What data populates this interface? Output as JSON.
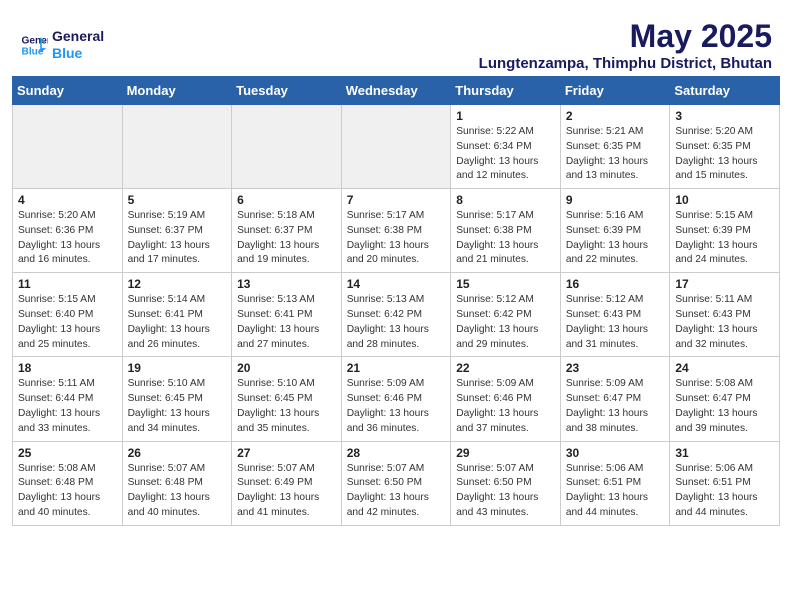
{
  "header": {
    "logo_line1": "General",
    "logo_line2": "Blue",
    "month": "May 2025",
    "location": "Lungtenzampa, Thimphu District, Bhutan"
  },
  "days_of_week": [
    "Sunday",
    "Monday",
    "Tuesday",
    "Wednesday",
    "Thursday",
    "Friday",
    "Saturday"
  ],
  "weeks": [
    [
      {
        "day": "",
        "empty": true
      },
      {
        "day": "",
        "empty": true
      },
      {
        "day": "",
        "empty": true
      },
      {
        "day": "",
        "empty": true
      },
      {
        "day": "1",
        "sunrise": "5:22 AM",
        "sunset": "6:34 PM",
        "daylight": "13 hours and 12 minutes."
      },
      {
        "day": "2",
        "sunrise": "5:21 AM",
        "sunset": "6:35 PM",
        "daylight": "13 hours and 13 minutes."
      },
      {
        "day": "3",
        "sunrise": "5:20 AM",
        "sunset": "6:35 PM",
        "daylight": "13 hours and 15 minutes."
      }
    ],
    [
      {
        "day": "4",
        "sunrise": "5:20 AM",
        "sunset": "6:36 PM",
        "daylight": "13 hours and 16 minutes."
      },
      {
        "day": "5",
        "sunrise": "5:19 AM",
        "sunset": "6:37 PM",
        "daylight": "13 hours and 17 minutes."
      },
      {
        "day": "6",
        "sunrise": "5:18 AM",
        "sunset": "6:37 PM",
        "daylight": "13 hours and 19 minutes."
      },
      {
        "day": "7",
        "sunrise": "5:17 AM",
        "sunset": "6:38 PM",
        "daylight": "13 hours and 20 minutes."
      },
      {
        "day": "8",
        "sunrise": "5:17 AM",
        "sunset": "6:38 PM",
        "daylight": "13 hours and 21 minutes."
      },
      {
        "day": "9",
        "sunrise": "5:16 AM",
        "sunset": "6:39 PM",
        "daylight": "13 hours and 22 minutes."
      },
      {
        "day": "10",
        "sunrise": "5:15 AM",
        "sunset": "6:39 PM",
        "daylight": "13 hours and 24 minutes."
      }
    ],
    [
      {
        "day": "11",
        "sunrise": "5:15 AM",
        "sunset": "6:40 PM",
        "daylight": "13 hours and 25 minutes."
      },
      {
        "day": "12",
        "sunrise": "5:14 AM",
        "sunset": "6:41 PM",
        "daylight": "13 hours and 26 minutes."
      },
      {
        "day": "13",
        "sunrise": "5:13 AM",
        "sunset": "6:41 PM",
        "daylight": "13 hours and 27 minutes."
      },
      {
        "day": "14",
        "sunrise": "5:13 AM",
        "sunset": "6:42 PM",
        "daylight": "13 hours and 28 minutes."
      },
      {
        "day": "15",
        "sunrise": "5:12 AM",
        "sunset": "6:42 PM",
        "daylight": "13 hours and 29 minutes."
      },
      {
        "day": "16",
        "sunrise": "5:12 AM",
        "sunset": "6:43 PM",
        "daylight": "13 hours and 31 minutes."
      },
      {
        "day": "17",
        "sunrise": "5:11 AM",
        "sunset": "6:43 PM",
        "daylight": "13 hours and 32 minutes."
      }
    ],
    [
      {
        "day": "18",
        "sunrise": "5:11 AM",
        "sunset": "6:44 PM",
        "daylight": "13 hours and 33 minutes."
      },
      {
        "day": "19",
        "sunrise": "5:10 AM",
        "sunset": "6:45 PM",
        "daylight": "13 hours and 34 minutes."
      },
      {
        "day": "20",
        "sunrise": "5:10 AM",
        "sunset": "6:45 PM",
        "daylight": "13 hours and 35 minutes."
      },
      {
        "day": "21",
        "sunrise": "5:09 AM",
        "sunset": "6:46 PM",
        "daylight": "13 hours and 36 minutes."
      },
      {
        "day": "22",
        "sunrise": "5:09 AM",
        "sunset": "6:46 PM",
        "daylight": "13 hours and 37 minutes."
      },
      {
        "day": "23",
        "sunrise": "5:09 AM",
        "sunset": "6:47 PM",
        "daylight": "13 hours and 38 minutes."
      },
      {
        "day": "24",
        "sunrise": "5:08 AM",
        "sunset": "6:47 PM",
        "daylight": "13 hours and 39 minutes."
      }
    ],
    [
      {
        "day": "25",
        "sunrise": "5:08 AM",
        "sunset": "6:48 PM",
        "daylight": "13 hours and 40 minutes."
      },
      {
        "day": "26",
        "sunrise": "5:07 AM",
        "sunset": "6:48 PM",
        "daylight": "13 hours and 40 minutes."
      },
      {
        "day": "27",
        "sunrise": "5:07 AM",
        "sunset": "6:49 PM",
        "daylight": "13 hours and 41 minutes."
      },
      {
        "day": "28",
        "sunrise": "5:07 AM",
        "sunset": "6:50 PM",
        "daylight": "13 hours and 42 minutes."
      },
      {
        "day": "29",
        "sunrise": "5:07 AM",
        "sunset": "6:50 PM",
        "daylight": "13 hours and 43 minutes."
      },
      {
        "day": "30",
        "sunrise": "5:06 AM",
        "sunset": "6:51 PM",
        "daylight": "13 hours and 44 minutes."
      },
      {
        "day": "31",
        "sunrise": "5:06 AM",
        "sunset": "6:51 PM",
        "daylight": "13 hours and 44 minutes."
      }
    ]
  ]
}
